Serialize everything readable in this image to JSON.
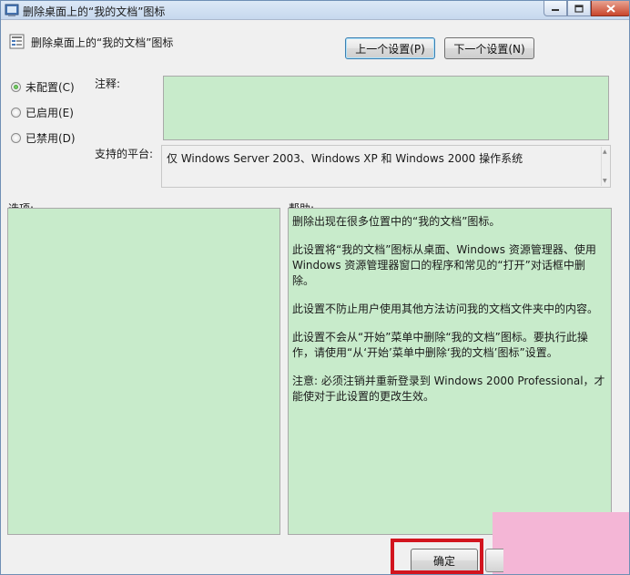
{
  "window": {
    "title": "删除桌面上的“我的文档”图标",
    "caption_buttons": [
      "minimize",
      "maximize",
      "close"
    ]
  },
  "header": {
    "setting_title": "删除桌面上的“我的文档”图标",
    "prev_button": "上一个设置(P)",
    "next_button": "下一个设置(N)"
  },
  "state": {
    "options": [
      {
        "label": "未配置(C)",
        "checked": true
      },
      {
        "label": "已启用(E)",
        "checked": false
      },
      {
        "label": "已禁用(D)",
        "checked": false
      }
    ]
  },
  "comment": {
    "label": "注释:",
    "value": ""
  },
  "platform": {
    "label": "支持的平台:",
    "value": "仅 Windows Server 2003、Windows XP 和 Windows 2000 操作系统"
  },
  "options_section": {
    "label": "选项:"
  },
  "help_section": {
    "label": "帮助:",
    "paragraphs": [
      "删除出现在很多位置中的“我的文档”图标。",
      "此设置将“我的文档”图标从桌面、Windows 资源管理器、使用 Windows 资源管理器窗口的程序和常见的“打开”对话框中删除。",
      "此设置不防止用户使用其他方法访问我的文档文件夹中的内容。",
      "此设置不会从“开始”菜单中删除“我的文档”图标。要执行此操作，请使用“从‘开始’菜单中删除‘我的文档’图标”设置。",
      "注意: 必须注销并重新登录到 Windows 2000 Professional，才能使对于此设置的更改生效。"
    ]
  },
  "footer": {
    "ok_button": "确定"
  },
  "colors": {
    "panel_green": "#c8ebcb",
    "highlight_red": "#d2141e",
    "overlay_pink": "#f4b6d6"
  }
}
